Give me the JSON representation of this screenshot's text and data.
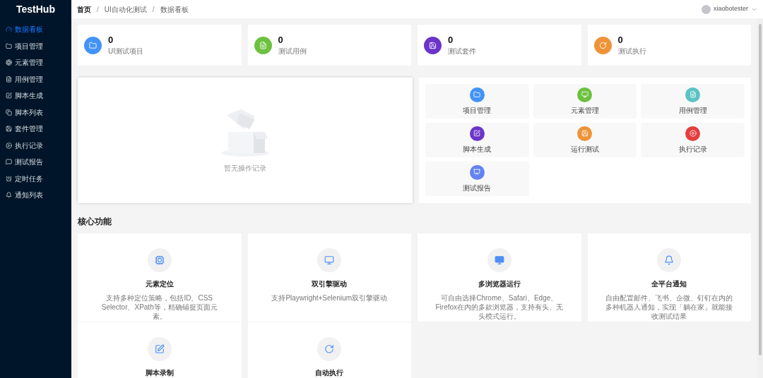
{
  "sidebar": {
    "logo": "TestHub",
    "items": [
      {
        "label": "数据看板",
        "selected": true
      },
      {
        "label": "项目管理",
        "selected": false
      },
      {
        "label": "元素管理",
        "selected": false
      },
      {
        "label": "用例管理",
        "selected": false
      },
      {
        "label": "脚本生成",
        "selected": false
      },
      {
        "label": "脚本列表",
        "selected": false
      },
      {
        "label": "套件管理",
        "selected": false
      },
      {
        "label": "执行记录",
        "selected": false
      },
      {
        "label": "测试报告",
        "selected": false
      },
      {
        "label": "定时任务",
        "selected": false
      },
      {
        "label": "通知列表",
        "selected": false
      }
    ]
  },
  "header": {
    "breadcrumb": [
      "首页",
      "UI自动化测试",
      "数据看板"
    ],
    "separator": "/",
    "user": "xiaobotester"
  },
  "stats": [
    {
      "value": "0",
      "label": "UI测试项目",
      "color": "#4393f7"
    },
    {
      "value": "0",
      "label": "测试用例",
      "color": "#6cc13f"
    },
    {
      "value": "0",
      "label": "测试套件",
      "color": "#6c35c9"
    },
    {
      "value": "0",
      "label": "测试执行",
      "color": "#ee9337"
    }
  ],
  "activity": {
    "empty_text": "暂无操作记录"
  },
  "quick_links": [
    {
      "label": "项目管理",
      "color": "#4393f7"
    },
    {
      "label": "元素管理",
      "color": "#6cc13f"
    },
    {
      "label": "用例管理",
      "color": "#5bc3c4"
    },
    {
      "label": "脚本生成",
      "color": "#6c35c9"
    },
    {
      "label": "运行测试",
      "color": "#ee9337"
    },
    {
      "label": "执行记录",
      "color": "#e53e3e"
    },
    {
      "label": "测试报告",
      "color": "#6383f0"
    }
  ],
  "core_features": {
    "title": "核心功能",
    "items": [
      {
        "title": "元素定位",
        "description": "支持多种定位策略，包括ID、CSS Selector、XPath等，精确铺捉页面元素。"
      },
      {
        "title": "双引擎驱动",
        "description": "支持Playwright+Selenium双引擎驱动"
      },
      {
        "title": "多浏览器运行",
        "description": "可自由选择Chrome、Safari、Edge、Firefox在内的多款浏览器，支持有头、无头模式运行。"
      },
      {
        "title": "全平台通知",
        "description": "自由配置邮件、飞书、企微、钉钉在内的多种机器人通知，实现「躺在家」就能接收测试结果"
      },
      {
        "title": "脚本录制"
      },
      {
        "title": "自动执行"
      }
    ]
  }
}
